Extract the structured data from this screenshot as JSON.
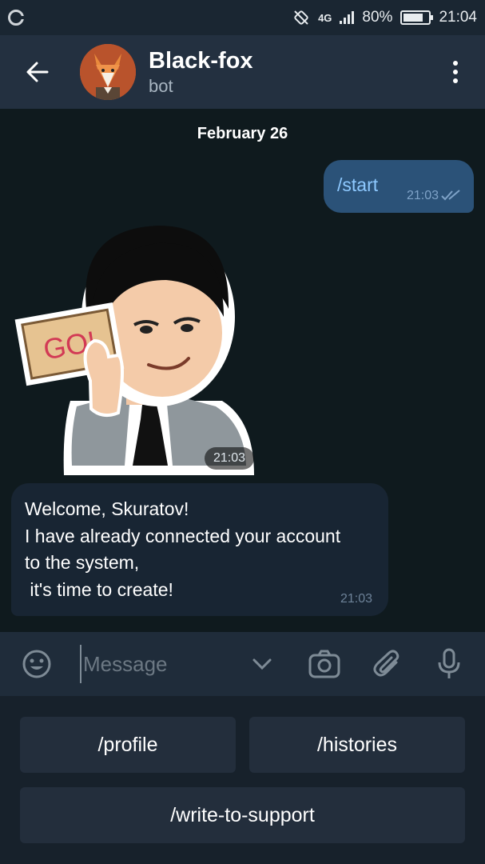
{
  "status_bar": {
    "network": "4G",
    "battery_percent": "80%",
    "battery_level": 0.8,
    "time": "21:04"
  },
  "header": {
    "title": "Black-fox",
    "subtitle": "bot",
    "icons": {
      "back": "arrow-left-icon",
      "menu": "more-vert-icon"
    }
  },
  "chat": {
    "date_separator": "February 26",
    "messages": [
      {
        "type": "outgoing",
        "text": "/start",
        "time": "21:03",
        "status": "read"
      },
      {
        "type": "sticker",
        "sticker_text": "GO!",
        "time": "21:03"
      },
      {
        "type": "incoming",
        "text": "Welcome, Skuratov!\nI have already connected your account\nto the system,\n it's time to create!",
        "time": "21:03"
      }
    ]
  },
  "composer": {
    "placeholder": "Message",
    "value": "",
    "icons": [
      "emoji-icon",
      "chevron-down-icon",
      "camera-icon",
      "attach-icon",
      "mic-icon"
    ]
  },
  "bot_keyboard": {
    "rows": [
      [
        "/profile",
        "/histories"
      ],
      [
        "/write-to-support"
      ]
    ]
  },
  "colors": {
    "header_bg": "#233040",
    "chat_bg": "#0f1a1e",
    "outgoing_bubble": "#2b5278",
    "incoming_bubble": "#182533",
    "keyboard_button": "#232e3c"
  }
}
